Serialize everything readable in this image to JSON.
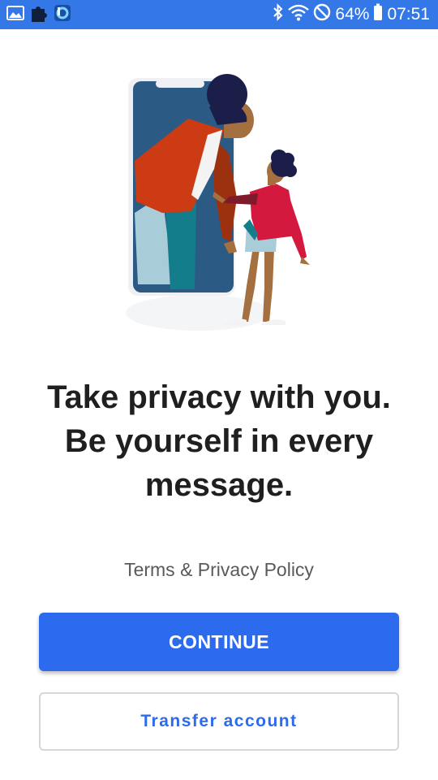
{
  "status_bar": {
    "battery": "64%",
    "time": "07:51",
    "left_icons": [
      "image-icon",
      "puzzle-icon",
      "app-icon"
    ],
    "right_icons": [
      "bluetooth-icon",
      "wifi-icon",
      "do-not-disturb-icon",
      "battery-icon"
    ]
  },
  "headline": {
    "line1": "Take privacy with you.",
    "line2": "Be yourself in every",
    "line3": "message."
  },
  "terms_link": "Terms & Privacy Policy",
  "buttons": {
    "continue": "CONTINUE",
    "transfer": "Transfer account"
  },
  "colors": {
    "status_bar": "#3478e8",
    "primary": "#2c6bed",
    "headline": "#1f1f1f",
    "terms": "#5a5a5a"
  }
}
